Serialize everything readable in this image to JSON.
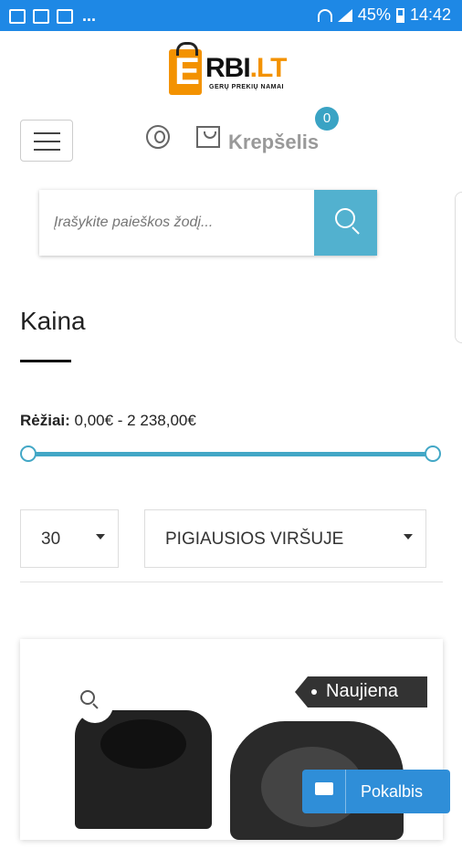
{
  "status_bar": {
    "battery": "45%",
    "time": "14:42",
    "more": "..."
  },
  "logo": {
    "letter": "E",
    "wordmark_main": "RBI",
    "wordmark_suffix": ".LT",
    "tagline": "GERŲ PREKIŲ NAMAI"
  },
  "header": {
    "cart_label": "Krepšelis",
    "cart_count": "0"
  },
  "search": {
    "placeholder": "Įrašykite paieškos žodį..."
  },
  "filter": {
    "title": "Kaina",
    "range_label": "Rėžiai:",
    "range_value": "0,00€ - 2 238,00€",
    "range_min": 0,
    "range_max": 2238
  },
  "toolbar": {
    "per_page": "30",
    "sort": "PIGIAUSIOS VIRŠUJE"
  },
  "product": {
    "badge": "Naujiena"
  },
  "chat": {
    "label": "Pokalbis"
  },
  "colors": {
    "status_bar": "#1e88e5",
    "accent": "#52b1cf",
    "logo_orange": "#f39200",
    "chat": "#2f8ed8"
  }
}
